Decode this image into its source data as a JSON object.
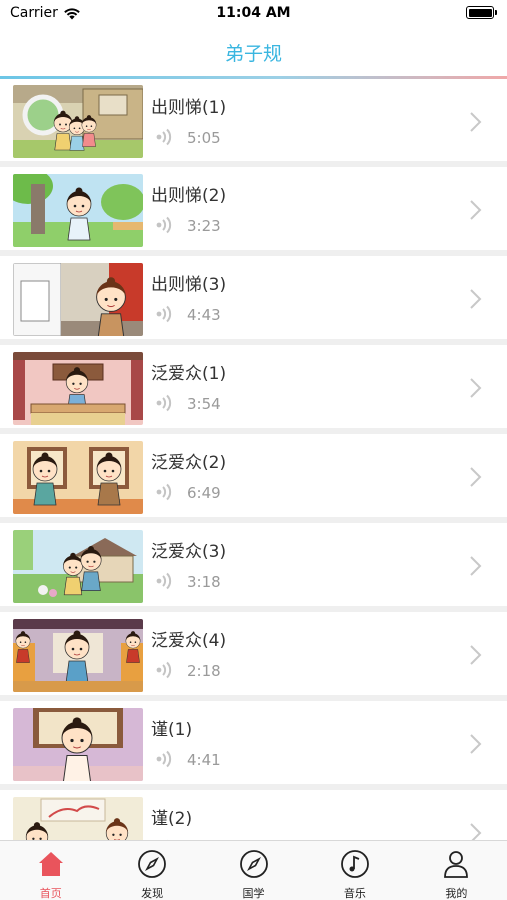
{
  "status_bar": {
    "carrier": "Carrier",
    "time": "11:04 AM"
  },
  "nav": {
    "title": "弟子规"
  },
  "lessons": [
    {
      "title": "出则悌(1)",
      "duration": "5:05"
    },
    {
      "title": "出则悌(2)",
      "duration": "3:23"
    },
    {
      "title": "出则悌(3)",
      "duration": "4:43"
    },
    {
      "title": "泛爱众(1)",
      "duration": "3:54"
    },
    {
      "title": "泛爱众(2)",
      "duration": "6:49"
    },
    {
      "title": "泛爱众(3)",
      "duration": "3:18"
    },
    {
      "title": "泛爱众(4)",
      "duration": "2:18"
    },
    {
      "title": "谨(1)",
      "duration": "4:41"
    },
    {
      "title": "谨(2)",
      "duration": ""
    }
  ],
  "tab_bar": {
    "tabs": [
      {
        "label": "首页",
        "icon": "home-icon",
        "active": true
      },
      {
        "label": "发现",
        "icon": "compass-icon",
        "active": false
      },
      {
        "label": "国学",
        "icon": "compass-icon",
        "active": false
      },
      {
        "label": "音乐",
        "icon": "music-note-icon",
        "active": false
      },
      {
        "label": "我的",
        "icon": "person-icon",
        "active": false
      }
    ]
  },
  "colors": {
    "accent": "#3ab6e0",
    "active_tab": "#e9545c",
    "duration_text": "#9a9a9a"
  }
}
